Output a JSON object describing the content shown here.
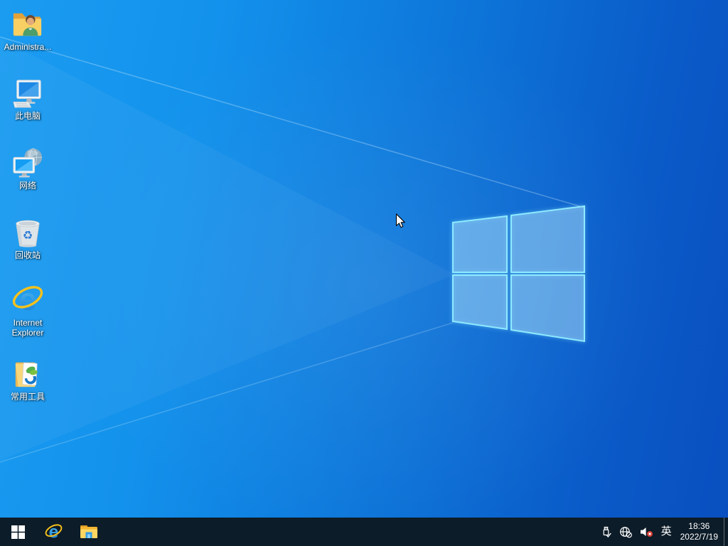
{
  "desktop": {
    "icons": [
      {
        "label": "Administra...",
        "icon": "user-folder-icon"
      },
      {
        "label": "此电脑",
        "icon": "this-pc-icon"
      },
      {
        "label": "网络",
        "icon": "network-globe-icon"
      },
      {
        "label": "回收站",
        "icon": "recycle-bin-icon"
      },
      {
        "label": "Internet Explorer",
        "icon": "internet-explorer-icon"
      },
      {
        "label": "常用工具",
        "icon": "tools-folder-icon"
      }
    ]
  },
  "wallpaper": {
    "name": "windows-10-light-rays",
    "logo": "windows-logo",
    "colors": {
      "gradient_left": "#1b9cf1",
      "gradient_right": "#094fc0",
      "logo_edge": "#8deaff"
    }
  },
  "taskbar": {
    "color": "#0c1c28",
    "buttons": [
      {
        "icon": "start-icon"
      },
      {
        "icon": "internet-explorer-icon"
      },
      {
        "icon": "file-explorer-icon"
      }
    ],
    "tray": {
      "icons": [
        {
          "icon": "usb-safe-remove-icon"
        },
        {
          "icon": "network-offline-icon"
        },
        {
          "icon": "volume-muted-icon"
        }
      ],
      "ime_indicator": "英",
      "clock": {
        "time": "18:36",
        "date": "2022/7/19"
      }
    }
  }
}
